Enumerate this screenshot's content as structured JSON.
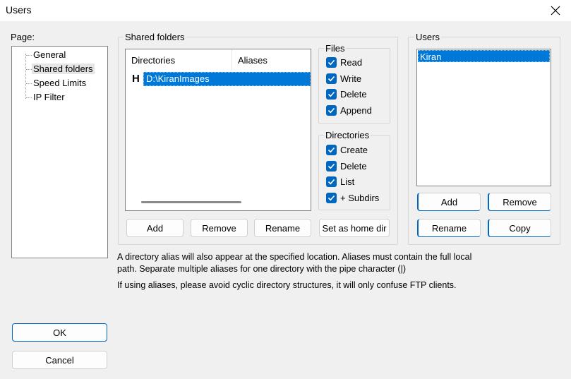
{
  "window": {
    "title": "Users"
  },
  "page_panel": {
    "label": "Page:",
    "items": [
      {
        "label": "General",
        "selected": false
      },
      {
        "label": "Shared folders",
        "selected": true
      },
      {
        "label": "Speed Limits",
        "selected": false
      },
      {
        "label": "IP Filter",
        "selected": false
      }
    ]
  },
  "shared_folders": {
    "group_title": "Shared folders",
    "columns": [
      "Directories",
      "Aliases"
    ],
    "rows": [
      {
        "marker": "H",
        "directory": "D:\\KiranImages",
        "alias": ""
      }
    ],
    "buttons": {
      "add": "Add",
      "remove": "Remove",
      "rename": "Rename",
      "set_home": "Set as home dir"
    }
  },
  "files_group": {
    "title": "Files",
    "options": [
      {
        "label": "Read",
        "checked": true
      },
      {
        "label": "Write",
        "checked": true
      },
      {
        "label": "Delete",
        "checked": true
      },
      {
        "label": "Append",
        "checked": true
      }
    ]
  },
  "directories_group": {
    "title": "Directories",
    "options": [
      {
        "label": "Create",
        "checked": true
      },
      {
        "label": "Delete",
        "checked": true
      },
      {
        "label": "List",
        "checked": true
      },
      {
        "label": "+ Subdirs",
        "checked": true
      }
    ]
  },
  "users_panel": {
    "title": "Users",
    "list": [
      "Kiran"
    ],
    "selected_index": 0,
    "buttons": {
      "add": "Add",
      "remove": "Remove",
      "rename": "Rename",
      "copy": "Copy"
    }
  },
  "notes": {
    "alias_line1": "A directory alias will also appear at the specified location. Aliases must contain the full local",
    "alias_line2": "path. Separate multiple aliases for one directory with the pipe character (|)",
    "cyclic": "If using aliases, please avoid cyclic directory structures, it will only confuse FTP clients."
  },
  "dialog_buttons": {
    "ok": "OK",
    "cancel": "Cancel"
  },
  "colors": {
    "accent": "#0067c0",
    "selection": "#0078d7",
    "background": "#f0f0f0"
  }
}
